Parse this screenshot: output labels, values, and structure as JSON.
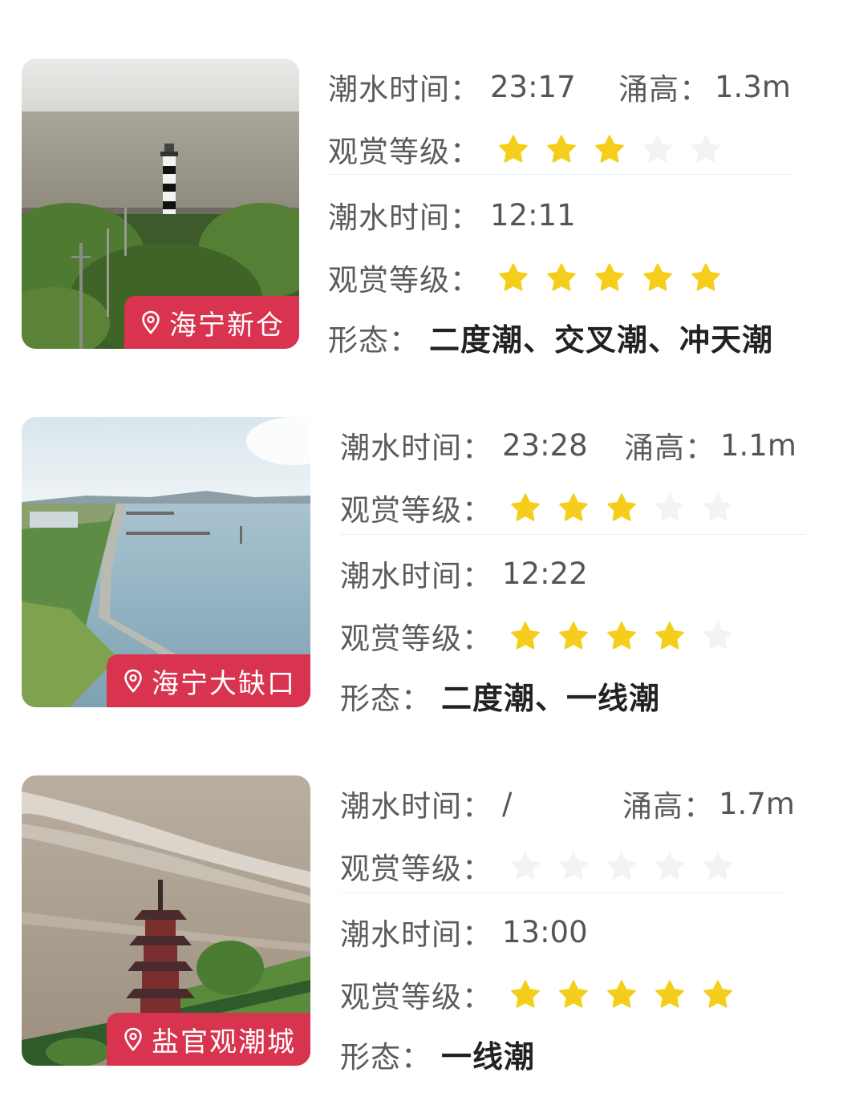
{
  "colors": {
    "badge": "#d8344f",
    "star_on": "#f5cd1b",
    "star_off": "#f3f3f3"
  },
  "locations": [
    {
      "name": "海宁新仓",
      "tide1": {
        "time_label": "潮水时间：",
        "time": "23:17",
        "height_label": "涌高：",
        "height": "1.3m",
        "rating_label": "观赏等级：",
        "rating": 3
      },
      "tide2": {
        "time_label": "潮水时间：",
        "time": "12:11",
        "rating_label": "观赏等级：",
        "rating": 5
      },
      "form_label": "形态：",
      "form": "二度潮、交叉潮、冲天潮"
    },
    {
      "name": "海宁大缺口",
      "tide1": {
        "time_label": "潮水时间：",
        "time": "23:28",
        "height_label": "涌高：",
        "height": "1.1m",
        "rating_label": "观赏等级：",
        "rating": 3
      },
      "tide2": {
        "time_label": "潮水时间：",
        "time": "12:22",
        "rating_label": "观赏等级：",
        "rating": 4
      },
      "form_label": "形态：",
      "form": "二度潮、一线潮"
    },
    {
      "name": "盐官观潮城",
      "tide1": {
        "time_label": "潮水时间：",
        "time": "/",
        "height_label": "涌高：",
        "height": "1.7m",
        "rating_label": "观赏等级：",
        "rating": 0
      },
      "tide2": {
        "time_label": "潮水时间：",
        "time": "13:00",
        "rating_label": "观赏等级：",
        "rating": 5
      },
      "form_label": "形态：",
      "form": "一线潮"
    }
  ]
}
